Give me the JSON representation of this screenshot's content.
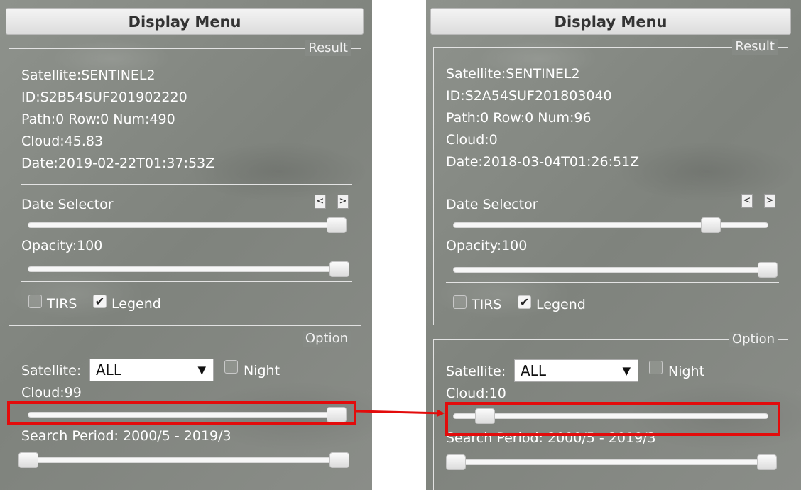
{
  "panels": [
    {
      "menu_title": "Display Menu",
      "result_legend": "Result",
      "info": [
        "Satellite:SENTINEL2",
        "ID:S2B54SUF201902220",
        "Path:0 Row:0 Num:490",
        "Cloud:45.83",
        "Date:2019-02-22T01:37:53Z"
      ],
      "date_selector_label": "Date Selector",
      "prev_label": "<",
      "next_label": ">",
      "date_slider_fraction": 0.99,
      "opacity_label": "Opacity:100",
      "opacity_fraction": 1.0,
      "tirs_label": "TIRS",
      "tirs_checked": false,
      "legend_label": "Legend",
      "legend_checked": true,
      "option_legend": "Option",
      "satellite_label": "Satellite:",
      "satellite_value": "ALL",
      "select_arrow": "▼",
      "night_label": "Night",
      "night_checked": false,
      "cloud_label": "Cloud:99",
      "cloud_fraction": 0.99,
      "search_period_label": "Search Period: 2000/5 -  2019/3",
      "search_period_start_fraction": 0.0,
      "search_period_end_fraction": 1.0
    },
    {
      "menu_title": "Display Menu",
      "result_legend": "Result",
      "info": [
        "Satellite:SENTINEL2",
        "ID:S2A54SUF201803040",
        "Path:0 Row:0 Num:96",
        "Cloud:0",
        "Date:2018-03-04T01:26:51Z"
      ],
      "date_selector_label": "Date Selector",
      "prev_label": "<",
      "next_label": ">",
      "date_slider_fraction": 0.82,
      "opacity_label": "Opacity:100",
      "opacity_fraction": 1.0,
      "tirs_label": "TIRS",
      "tirs_checked": false,
      "legend_label": "Legend",
      "legend_checked": true,
      "option_legend": "Option",
      "satellite_label": "Satellite:",
      "satellite_value": "ALL",
      "select_arrow": "▼",
      "night_label": "Night",
      "night_checked": false,
      "cloud_label": "Cloud:10",
      "cloud_fraction": 0.1,
      "search_period_label": "Search Period: 2000/5 -  2019/3",
      "search_period_start_fraction": 0.0,
      "search_period_end_fraction": 1.0
    }
  ],
  "check_glyph": "✔",
  "highlight_color": "#e30b0b"
}
